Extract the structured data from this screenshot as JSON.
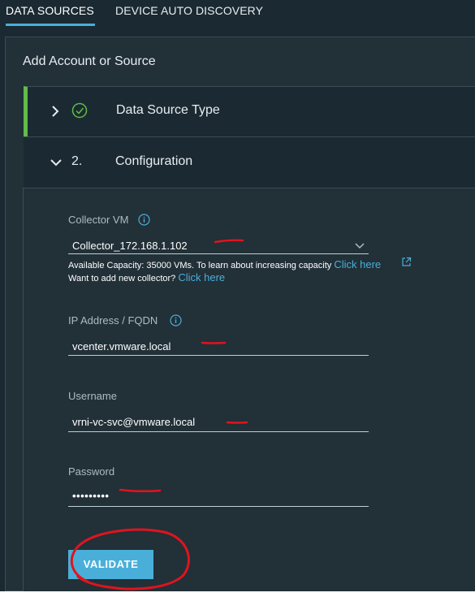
{
  "tabs": [
    {
      "label": "DATA SOURCES",
      "active": true
    },
    {
      "label": "DEVICE AUTO DISCOVERY",
      "active": false
    }
  ],
  "panel": {
    "title": "Add Account or Source"
  },
  "steps": [
    {
      "number": "",
      "label": "Data Source Type",
      "status": "completed",
      "chevron": "chevron-right-icon"
    },
    {
      "number": "2.",
      "label": "Configuration",
      "status": "expanded",
      "chevron": "chevron-down-icon"
    }
  ],
  "form": {
    "collector": {
      "label": "Collector VM",
      "value": "Collector_172.168.1.102",
      "capacity_text": "Available Capacity: 35000 VMs. To learn about increasing capacity",
      "capacity_link": "Click here",
      "add_text": "Want to add new collector?",
      "add_link": "Click here"
    },
    "ip": {
      "label": "IP Address / FQDN",
      "value": "vcenter.vmware.local"
    },
    "username": {
      "label": "Username",
      "value": "vrni-vc-svc@vmware.local"
    },
    "password": {
      "label": "Password",
      "value": "•••••••••"
    }
  },
  "validate_label": "VALIDATE",
  "colors": {
    "background": "#1b2a32",
    "panel": "#223038",
    "accent": "#49afd9",
    "success": "#62bd47",
    "annotation": "#e0141e"
  }
}
